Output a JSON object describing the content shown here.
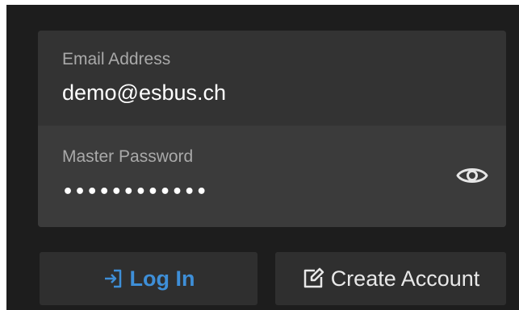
{
  "login_form": {
    "email": {
      "label": "Email Address",
      "value": "demo@esbus.ch"
    },
    "password": {
      "label": "Master Password",
      "masked_value": "••••••••••••",
      "toggle_icon": "eye-icon"
    }
  },
  "actions": {
    "login_label": "Log In",
    "login_icon": "sign-in-icon",
    "create_label": "Create Account",
    "create_icon": "edit-icon"
  },
  "colors": {
    "background": "#1d1d1d",
    "panel": "#333333",
    "password_panel": "#3b3b3b",
    "accent": "#3e8fd8",
    "button": "#2f2f2f"
  }
}
